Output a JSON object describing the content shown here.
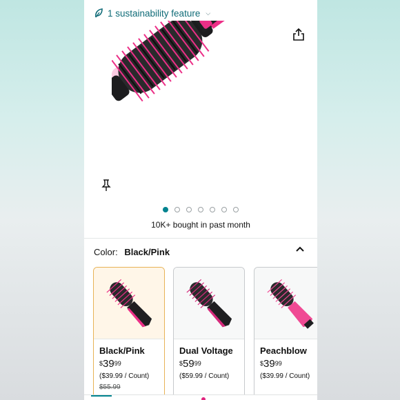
{
  "header": {
    "sustainability_label": "1 sustainability feature",
    "leaf_icon": "leaf-icon",
    "chevron_icon": "chevron-down-icon",
    "share_icon": "share-icon",
    "pin_icon": "pin-icon"
  },
  "gallery": {
    "image_count": 7,
    "active_index": 0,
    "bought_text": "10K+ bought in past month"
  },
  "color": {
    "label": "Color:",
    "selected": "Black/Pink",
    "collapse_icon": "chevron-up-icon"
  },
  "variants": [
    {
      "name": "Black/Pink",
      "currency": "$",
      "whole": "39",
      "fraction": "99",
      "unit_price": "($39.99 / Count)",
      "was_price": "$55.99",
      "selected": true,
      "accent": "#ec2f87"
    },
    {
      "name": "Dual Voltage",
      "currency": "$",
      "whole": "59",
      "fraction": "99",
      "unit_price": "($59.99 / Count)",
      "was_price": "",
      "selected": false,
      "accent": "#d62a7c"
    },
    {
      "name": "Peachblow",
      "currency": "$",
      "whole": "39",
      "fraction": "99",
      "unit_price": "($39.99 / Count)",
      "was_price": "",
      "selected": false,
      "accent": "#f04a94"
    }
  ],
  "colors": {
    "brand_teal": "#00838f",
    "selection_border": "#e7b255",
    "pink": "#ec2f87"
  }
}
